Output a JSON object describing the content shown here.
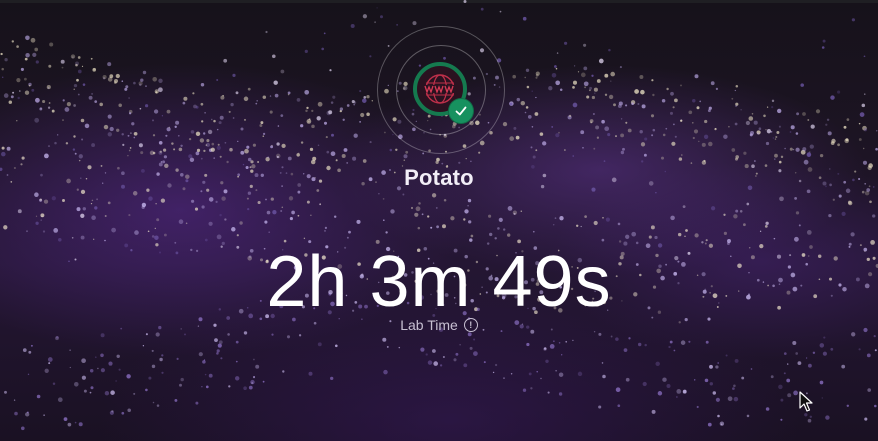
{
  "lab": {
    "name": "Potato",
    "completed": true,
    "logo_icon": "www-globe-icon",
    "status_icon": "checkmark-icon"
  },
  "timer": {
    "value": "2h 3m 49s",
    "label": "Lab Time",
    "info_icon": "info-circle-icon"
  },
  "colors": {
    "background": "#1d1424",
    "accent_purple": "#5c2c96",
    "success_green": "#17915f",
    "logo_red": "#c0304a",
    "text_primary": "#ffffff",
    "text_secondary": "#c7c0d2"
  }
}
